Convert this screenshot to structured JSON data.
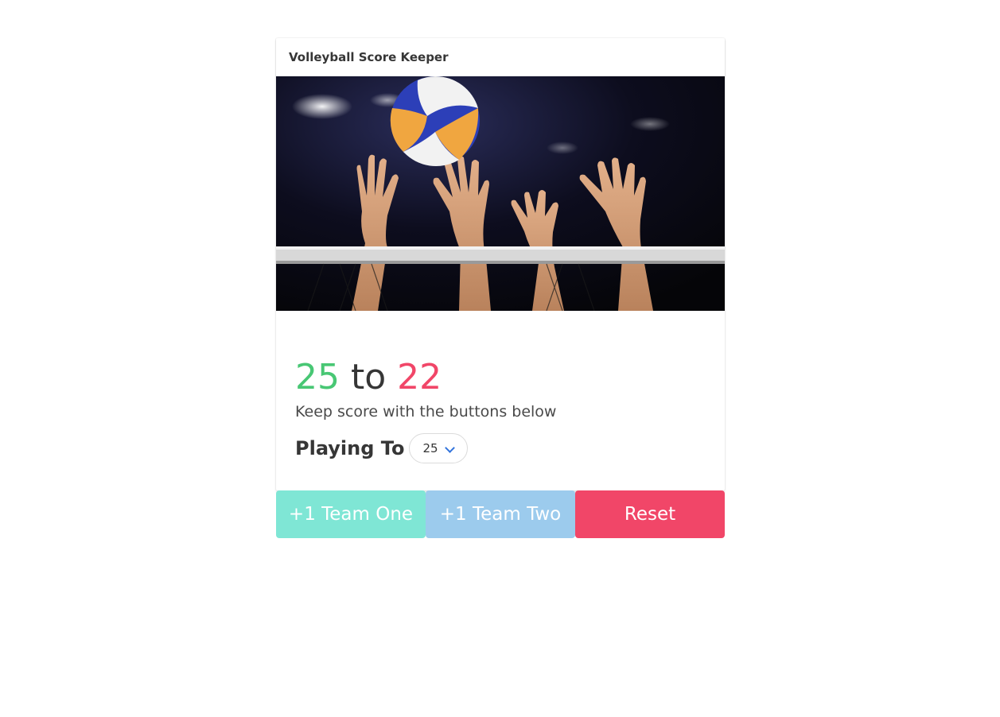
{
  "card": {
    "title": "Volleyball Score Keeper"
  },
  "image": {
    "subject": "volleyball-over-net-with-hands"
  },
  "score": {
    "team_one": "25",
    "separator": "to",
    "team_two": "22"
  },
  "subtitle": "Keep score with the buttons below",
  "playing_to": {
    "label": "Playing To",
    "selected": "25"
  },
  "buttons": {
    "team_one": "+1 Team One",
    "team_two": "+1 Team Two",
    "reset": "Reset"
  },
  "colors": {
    "team_one_score": "#48c774",
    "team_two_score": "#f14668",
    "team_one_button": "#7fe6d5",
    "team_two_button": "#9ccbed",
    "reset_button": "#f14668",
    "select_arrow": "#3273dc"
  }
}
